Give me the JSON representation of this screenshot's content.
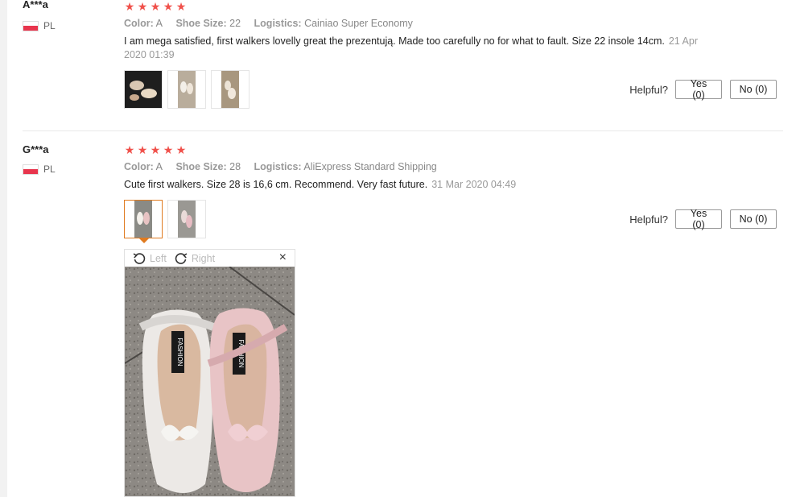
{
  "reviews": [
    {
      "user": "A***a",
      "country": "PL",
      "rating": 5,
      "attributes": {
        "color_label": "Color:",
        "color_value": "A",
        "size_label": "Shoe Size:",
        "size_value": "22",
        "logistics_label": "Logistics:",
        "logistics_value": "Cainiao Super Economy"
      },
      "text": "I am mega satisfied, first walkers lovelly great the prezentują. Made too carefully no for what to fault. Size 22 insole 14cm.",
      "date": "21 Apr 2020 01:39",
      "helpful_label": "Helpful?",
      "yes_label": "Yes (0)",
      "no_label": "No (0)"
    },
    {
      "user": "G***a",
      "country": "PL",
      "rating": 5,
      "attributes": {
        "color_label": "Color:",
        "color_value": "A",
        "size_label": "Shoe Size:",
        "size_value": "28",
        "logistics_label": "Logistics:",
        "logistics_value": "AliExpress Standard Shipping"
      },
      "text": "Cute first walkers. Size 28 is 16,6 cm. Recommend. Very fast future.",
      "date": "31 Mar 2020 04:49",
      "helpful_label": "Helpful?",
      "yes_label": "Yes (0)",
      "no_label": "No (0)"
    }
  ],
  "viewer": {
    "rotate_left_label": "Left",
    "rotate_right_label": "Right",
    "close_symbol": "×",
    "photo_text_left": "FASHION",
    "photo_text_right": "FASHION"
  },
  "colors": {
    "star": "#f0514b",
    "selected_thumb": "#e07b20",
    "flag_red": "#e8354d"
  },
  "icons": [
    "star-icon",
    "flag-icon",
    "rotate-left-icon",
    "rotate-right-icon",
    "close-icon"
  ]
}
